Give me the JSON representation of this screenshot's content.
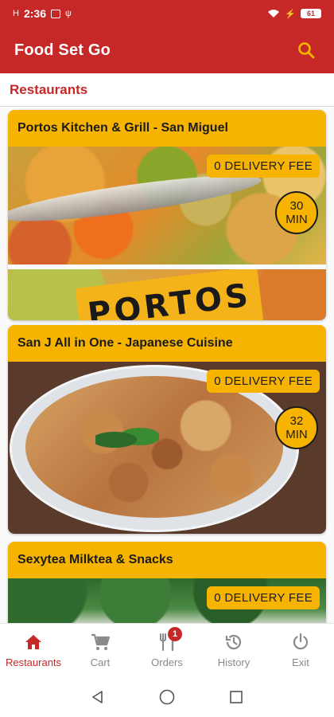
{
  "status_bar": {
    "time": "2:36",
    "battery": "61"
  },
  "app_bar": {
    "title": "Food Set Go"
  },
  "section": {
    "title": "Restaurants"
  },
  "restaurants": [
    {
      "name": "Portos Kitchen & Grill - San Miguel",
      "delivery_fee": "0 DELIVERY FEE",
      "time_value": "30",
      "time_unit": "MIN",
      "sign_text": "PORTOS"
    },
    {
      "name": "San J All in One - Japanese Cuisine",
      "delivery_fee": "0 DELIVERY FEE",
      "time_value": "32",
      "time_unit": "MIN"
    },
    {
      "name": "Sexytea Milktea & Snacks",
      "delivery_fee": "0 DELIVERY FEE"
    }
  ],
  "bottom_nav": {
    "items": [
      {
        "label": "Restaurants",
        "icon": "home-icon",
        "active": true
      },
      {
        "label": "Cart",
        "icon": "cart-icon"
      },
      {
        "label": "Orders",
        "icon": "fork-knife-icon",
        "badge": "1"
      },
      {
        "label": "History",
        "icon": "history-icon"
      },
      {
        "label": "Exit",
        "icon": "power-icon"
      }
    ]
  },
  "colors": {
    "primary": "#c62828",
    "accent": "#f6b400"
  }
}
